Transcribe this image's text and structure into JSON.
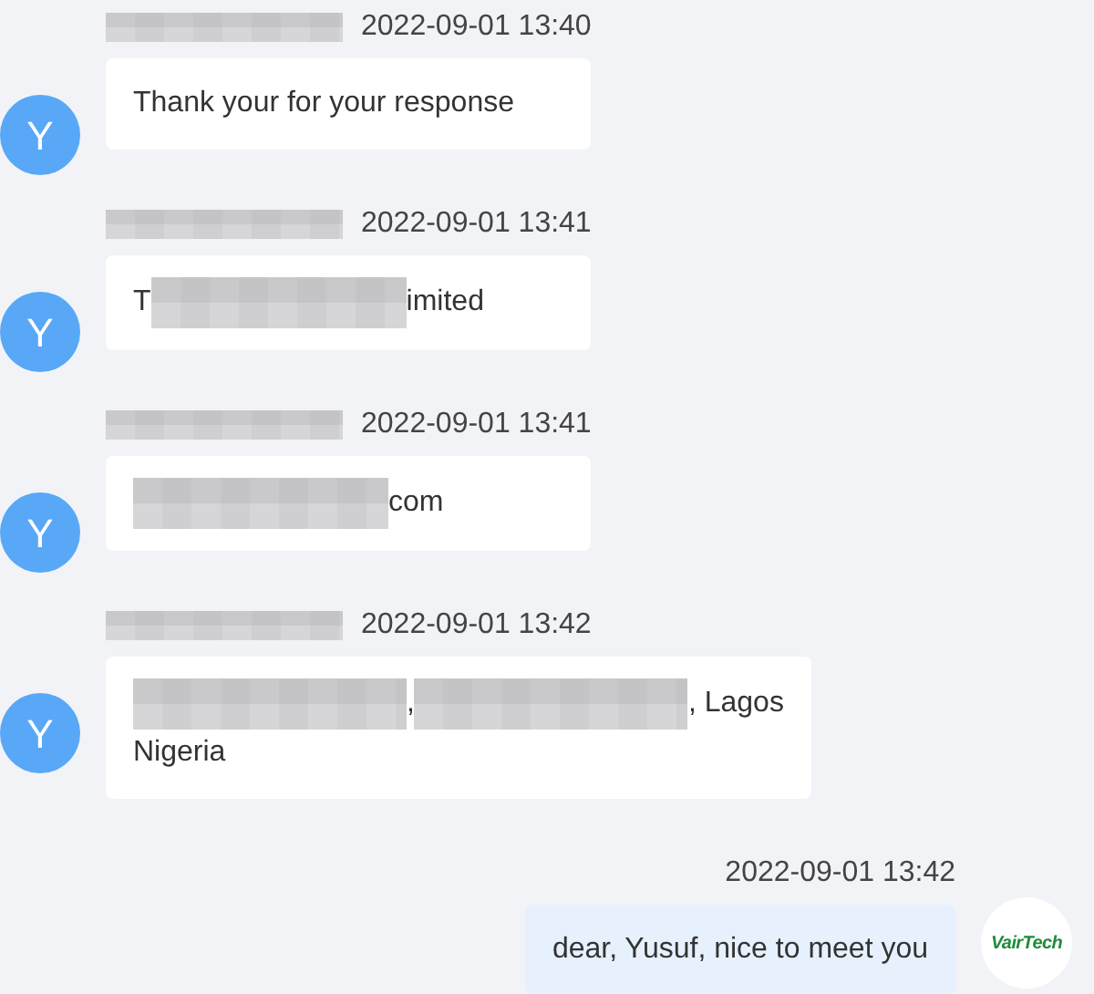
{
  "messages": [
    {
      "kind": "incoming",
      "avatar": "Y",
      "sender_redacted": true,
      "time": "2022-09-01 13:40",
      "body": [
        {
          "kind": "text",
          "text": "Thank your for your response"
        }
      ]
    },
    {
      "kind": "incoming",
      "avatar": "Y",
      "sender_redacted": true,
      "time": "2022-09-01 13:41",
      "body": [
        {
          "kind": "text",
          "text": "T"
        },
        {
          "kind": "redacted"
        },
        {
          "kind": "text",
          "text": "imited"
        }
      ]
    },
    {
      "kind": "incoming",
      "avatar": "Y",
      "sender_redacted": true,
      "time": "2022-09-01 13:41",
      "body": [
        {
          "kind": "redacted"
        },
        {
          "kind": "text",
          "text": "com"
        }
      ]
    },
    {
      "kind": "incoming",
      "avatar": "Y",
      "sender_redacted": true,
      "time": "2022-09-01 13:42",
      "body": [
        {
          "kind": "redacted"
        },
        {
          "kind": "text",
          "text": ","
        },
        {
          "kind": "redacted"
        },
        {
          "kind": "text",
          "text": ", Lagos"
        },
        {
          "kind": "line",
          "text": "Nigeria"
        }
      ]
    },
    {
      "kind": "outgoing",
      "avatar": "VairTech",
      "sender_redacted": false,
      "time": "2022-09-01 13:42",
      "body": [
        {
          "kind": "text",
          "text": "dear, Yusuf, nice to meet you"
        }
      ]
    }
  ]
}
